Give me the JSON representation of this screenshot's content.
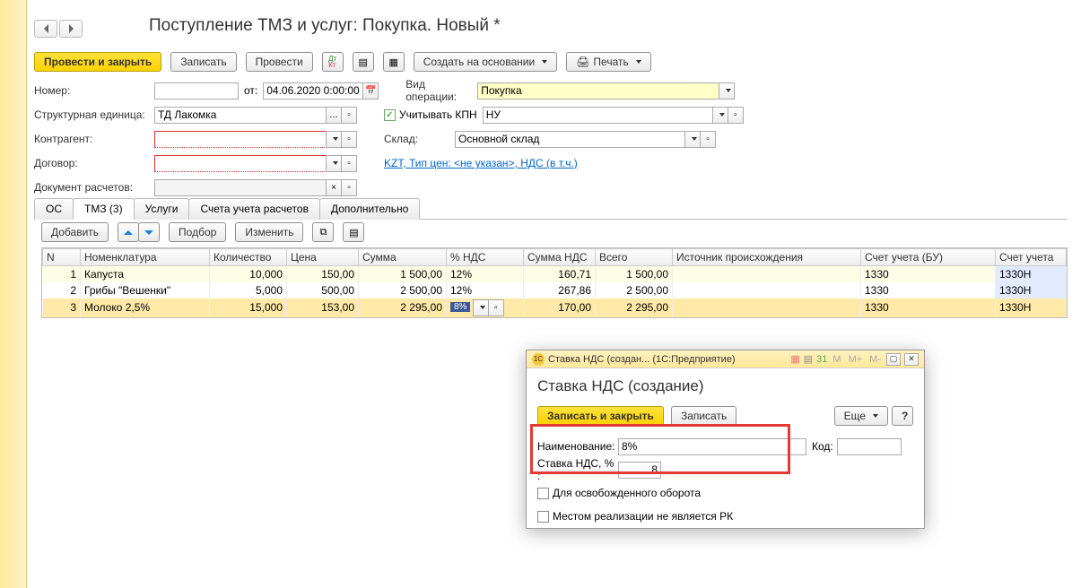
{
  "title": "Поступление ТМЗ и услуг: Покупка. Новый *",
  "toolbar": {
    "post_close": "Провести и закрыть",
    "save": "Записать",
    "post": "Провести",
    "create_based": "Создать на основании",
    "print": "Печать"
  },
  "form": {
    "number_lbl": "Номер:",
    "from_lbl": "от:",
    "date": "04.06.2020 0:00:00",
    "oper_lbl": "Вид операции:",
    "oper_val": "Покупка",
    "orgunit_lbl": "Структурная единица:",
    "orgunit_val": "ТД Лакомка",
    "kpn_lbl": "Учитывать КПН",
    "kpn_val": "НУ",
    "contragent_lbl": "Контрагент:",
    "warehouse_lbl": "Склад:",
    "warehouse_val": "Основной склад",
    "contract_lbl": "Договор:",
    "price_info": "KZT, Тип цен: <не указан>, НДС (в т.ч.)",
    "calcdoc_lbl": "Документ расчетов:"
  },
  "tabs": [
    "ОС",
    "ТМЗ (3)",
    "Услуги",
    "Счета учета расчетов",
    "Дополнительно"
  ],
  "active_tab": 1,
  "subtoolbar": {
    "add": "Добавить",
    "pick": "Подбор",
    "edit": "Изменить"
  },
  "cols": [
    "N",
    "Номенклатура",
    "Количество",
    "Цена",
    "Сумма",
    "% НДС",
    "Сумма НДС",
    "Всего",
    "Источник происхождения",
    "Счет учета (БУ)",
    "Счет учета"
  ],
  "rows": [
    {
      "n": "1",
      "nom": "Капуста",
      "qty": "10,000",
      "price": "150,00",
      "sum": "1 500,00",
      "vat": "12%",
      "vatsum": "160,71",
      "total": "1 500,00",
      "src": "",
      "acc": "1330",
      "acc2": "1330Н"
    },
    {
      "n": "2",
      "nom": "Грибы \"Вешенки\"",
      "qty": "5,000",
      "price": "500,00",
      "sum": "2 500,00",
      "vat": "12%",
      "vatsum": "267,86",
      "total": "2 500,00",
      "src": "",
      "acc": "1330",
      "acc2": "1330Н"
    },
    {
      "n": "3",
      "nom": "Молоко 2,5%",
      "qty": "15,000",
      "price": "153,00",
      "sum": "2 295,00",
      "vat": "8%",
      "vatsum": "170,00",
      "total": "2 295,00",
      "src": "",
      "acc": "1330",
      "acc2": "1330Н"
    }
  ],
  "dialog": {
    "wintitle": "Ставка НДС (создан... (1С:Предприятие)",
    "heading": "Ставка НДС (создание)",
    "save_close": "Записать и закрыть",
    "save": "Записать",
    "more": "Еще",
    "name_lbl": "Наименование:",
    "name_val": "8%",
    "code_lbl": "Код:",
    "rate_lbl": "Ставка НДС, % :",
    "rate_val": "8",
    "cb1": "Для освобожденного оборота",
    "cb2": "Местом реализации не является РК"
  }
}
